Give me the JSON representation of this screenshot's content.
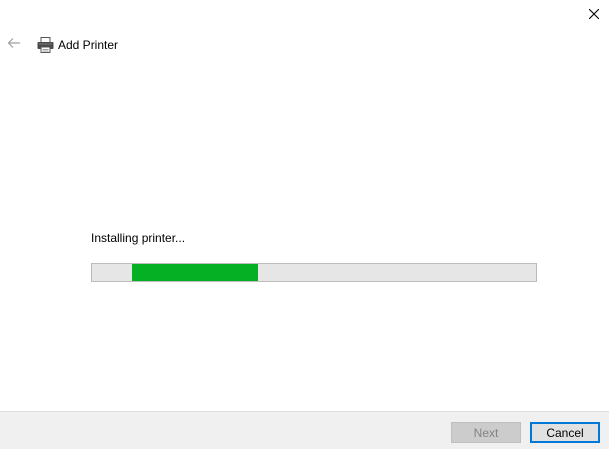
{
  "window": {
    "title": "Add Printer",
    "close_icon": "close-icon",
    "back_icon": "back-arrow-icon",
    "app_icon": "printer-icon"
  },
  "main": {
    "status_text": "Installing printer...",
    "progress": {
      "start_fraction": 0.09,
      "end_fraction": 0.375,
      "indeterminate": true,
      "color": "#06b025"
    }
  },
  "footer": {
    "next_label": "Next",
    "next_enabled": false,
    "cancel_label": "Cancel",
    "cancel_focused": true,
    "accent_color": "#0078d7"
  }
}
